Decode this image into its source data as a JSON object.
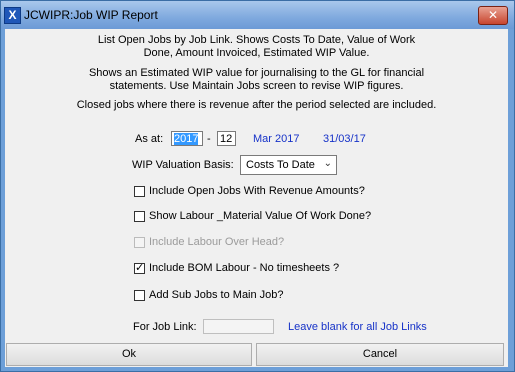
{
  "window": {
    "title": "JCWIPR:Job WIP Report",
    "close_symbol": "✕",
    "app_icon": "X"
  },
  "description": [
    "List Open Jobs by Job Link. Shows Costs To Date, Value of Work",
    "Done, Amount Invoiced, Estimated WIP Value.",
    "Shows an Estimated  WIP value for journalising to the GL for financial",
    "statements. Use Maintain Jobs screen to revise WIP figures.",
    "Closed jobs where there is revenue after the period selected are included."
  ],
  "as_at": {
    "label": "As at:",
    "year": "2017",
    "separator": "-",
    "period": "12",
    "month_text": "Mar 2017",
    "date_text": "31/03/17"
  },
  "wip_basis": {
    "label": "WIP Valuation Basis:",
    "value": "Costs To Date"
  },
  "options": [
    {
      "label": "Include Open Jobs With Revenue Amounts?",
      "checked": false,
      "enabled": true
    },
    {
      "label": "Show Labour _Material Value Of Work Done?",
      "checked": false,
      "enabled": true
    },
    {
      "label": "Include Labour Over Head?",
      "checked": false,
      "enabled": false
    },
    {
      "label": "Include BOM Labour - No timesheets ?",
      "checked": true,
      "enabled": true
    },
    {
      "label": "Add Sub Jobs to Main Job?",
      "checked": false,
      "enabled": true
    }
  ],
  "job_link": {
    "label": "For Job Link:",
    "value": "",
    "hint": "Leave blank for all Job Links"
  },
  "buttons": {
    "ok": "Ok",
    "cancel": "Cancel"
  },
  "icons": {
    "app": "app-icon",
    "close": "close-icon",
    "dropdown": "chevron-down-icon",
    "check": "checkmark-icon"
  }
}
